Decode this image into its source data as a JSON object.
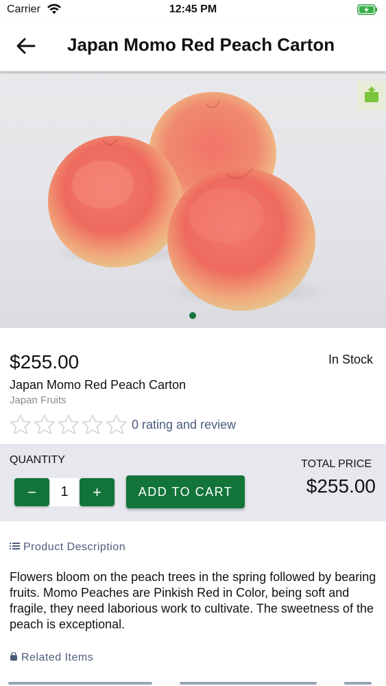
{
  "status_bar": {
    "carrier": "Carrier",
    "time": "12:45 PM"
  },
  "app_bar": {
    "title": "Japan Momo Red Peach Carton"
  },
  "gallery": {
    "image_description": "three red peaches",
    "dots": 1,
    "active_dot": 0
  },
  "product": {
    "price": "$255.00",
    "stock_status": "In Stock",
    "name": "Japan Momo Red Peach Carton",
    "category": "Japan Fruits",
    "rating_stars": 0,
    "rating_text": "0 rating and review"
  },
  "purchase": {
    "quantity_label": "QUANTITY",
    "quantity": "1",
    "minus_symbol": "−",
    "plus_symbol": "+",
    "add_to_cart_label": "ADD TO CART",
    "total_label": "TOTAL PRICE",
    "total_value": "$255.00"
  },
  "description": {
    "header": "Product Description",
    "text": "Flowers bloom on the peach trees in the spring followed by bearing fruits. Momo Peaches are Pinkish Red in Color, being soft and fragile, they need laborious work to cultivate. The sweetness of the peach is exceptional."
  },
  "related": {
    "header": "Related Items"
  },
  "colors": {
    "accent": "#13743a",
    "link": "#4c5a7a",
    "panel": "#e6e8ed"
  },
  "icons": [
    "wifi-icon",
    "battery-icon",
    "back-arrow-icon",
    "share-icon",
    "star-icon",
    "list-icon",
    "bag-icon"
  ]
}
